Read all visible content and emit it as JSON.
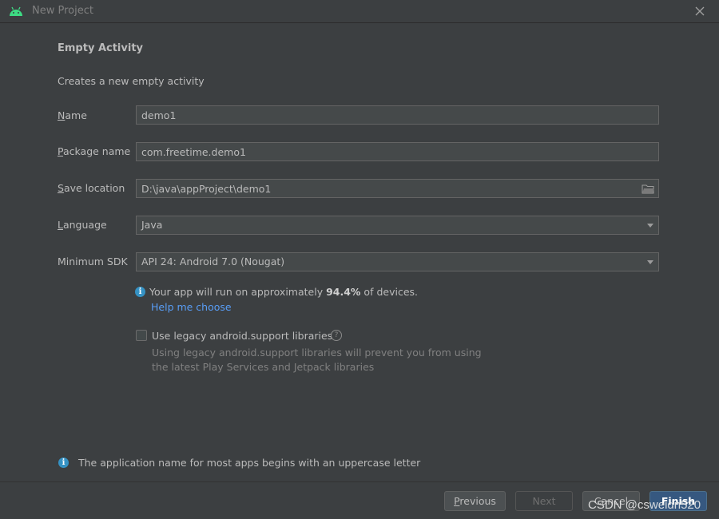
{
  "window": {
    "title": "New Project",
    "app_icon": "android-icon",
    "close_icon": "close-icon"
  },
  "template": {
    "heading": "Empty Activity",
    "subtitle": "Creates a new empty activity"
  },
  "form": {
    "name": {
      "label_mnemonic": "N",
      "label_rest": "ame",
      "value": "demo1"
    },
    "package_name": {
      "label_mnemonic": "P",
      "label_rest": "ackage name",
      "value": "com.freetime.demo1"
    },
    "save_location": {
      "label_mnemonic": "S",
      "label_rest": "ave location",
      "value": "D:\\java\\appProject\\demo1",
      "browse_icon": "folder-icon"
    },
    "language": {
      "label_mnemonic": "L",
      "label_rest": "anguage",
      "value": "Java"
    },
    "minimum_sdk": {
      "label": "Minimum SDK",
      "value": "API 24: Android 7.0 (Nougat)"
    }
  },
  "device_coverage": {
    "prefix": "Your app will run on approximately ",
    "percent": "94.4%",
    "suffix": " of devices.",
    "help_link": "Help me choose",
    "icon": "info-icon"
  },
  "legacy_support": {
    "label": "Use legacy android.support libraries",
    "checked": false,
    "help_icon": "question-icon",
    "description_line1": "Using legacy android.support libraries will prevent you from using",
    "description_line2": "the latest Play Services and Jetpack libraries"
  },
  "footer_info": "The application name for most apps begins with an uppercase letter",
  "buttons": {
    "previous": {
      "mnemonic": "P",
      "rest": "revious"
    },
    "next": "Next",
    "cancel": "Cancel",
    "finish": "Finish"
  },
  "watermark": "CSDN @csweidn520",
  "colors": {
    "background": "#3c3f41",
    "field_background": "#45494a",
    "link": "#589df6",
    "info": "#3592c4",
    "primary_button": "#365880"
  }
}
